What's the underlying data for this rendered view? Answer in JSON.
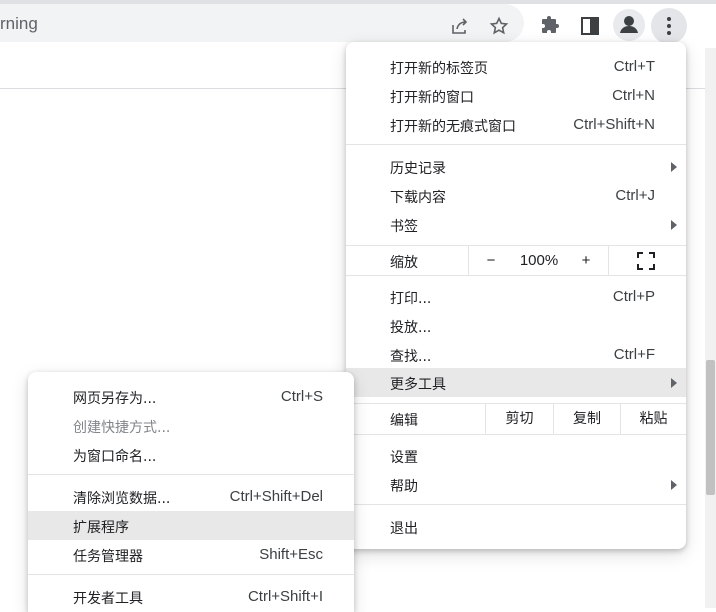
{
  "omnibox": {
    "text": "rning"
  },
  "main_menu": {
    "new_tab": {
      "label": "打开新的标签页",
      "shortcut": "Ctrl+T"
    },
    "new_window": {
      "label": "打开新的窗口",
      "shortcut": "Ctrl+N"
    },
    "new_incognito": {
      "label": "打开新的无痕式窗口",
      "shortcut": "Ctrl+Shift+N"
    },
    "history": {
      "label": "历史记录"
    },
    "downloads": {
      "label": "下载内容",
      "shortcut": "Ctrl+J"
    },
    "bookmarks": {
      "label": "书签"
    },
    "zoom": {
      "label": "缩放",
      "minus": "−",
      "value": "100%",
      "plus": "+"
    },
    "print": {
      "label": "打印...",
      "shortcut": "Ctrl+P"
    },
    "cast": {
      "label": "投放..."
    },
    "find": {
      "label": "查找...",
      "shortcut": "Ctrl+F"
    },
    "more_tools": {
      "label": "更多工具"
    },
    "edit": {
      "label": "编辑",
      "cut": "剪切",
      "copy": "复制",
      "paste": "粘贴"
    },
    "settings": {
      "label": "设置"
    },
    "help": {
      "label": "帮助"
    },
    "exit": {
      "label": "退出"
    }
  },
  "sub_menu": {
    "save_page": {
      "label": "网页另存为...",
      "shortcut": "Ctrl+S"
    },
    "create_shortcut": {
      "label": "创建快捷方式..."
    },
    "name_window": {
      "label": "为窗口命名..."
    },
    "clear_data": {
      "label": "清除浏览数据...",
      "shortcut": "Ctrl+Shift+Del"
    },
    "extensions": {
      "label": "扩展程序"
    },
    "task_manager": {
      "label": "任务管理器",
      "shortcut": "Shift+Esc"
    },
    "dev_tools": {
      "label": "开发者工具",
      "shortcut": "Ctrl+Shift+I"
    }
  },
  "icons": {
    "share": "share-icon",
    "bookmark": "star-icon",
    "extensions": "puzzle-icon",
    "side_panel": "side-panel-icon",
    "profile": "profile-icon",
    "menu": "kebab-menu-icon",
    "fullscreen": "fullscreen-icon"
  },
  "colors": {
    "highlight": "#e8e8e8",
    "icon": "#5f6368",
    "omnibox_bg": "#f1f3f4"
  }
}
